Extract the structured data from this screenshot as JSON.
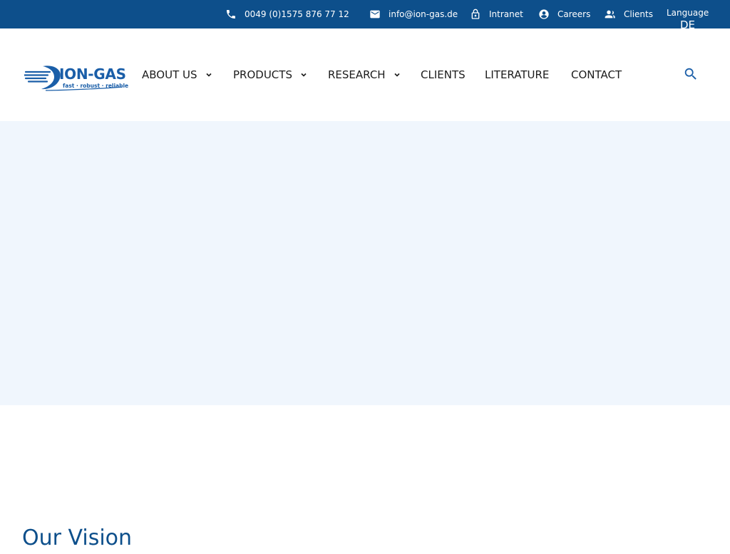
{
  "topbar": {
    "phone": {
      "icon": "phone-icon",
      "label": "0049 (0)1575 876 77 12"
    },
    "email": {
      "icon": "mail-icon",
      "label": "info@ion-gas.de"
    },
    "intranet": {
      "icon": "lock-icon",
      "label": "Intranet"
    },
    "careers": {
      "icon": "account-circle-icon",
      "label": "Careers"
    },
    "clients": {
      "icon": "people-icon",
      "label": "Clients"
    },
    "language": {
      "label": "Language",
      "selected": "DE"
    }
  },
  "logo": {
    "wordmark": "ION-GAS",
    "tagline": "fast · robust · reliable"
  },
  "nav": {
    "items": [
      {
        "label": "ABOUT US",
        "has_dropdown": true
      },
      {
        "label": "PRODUCTS",
        "has_dropdown": true
      },
      {
        "label": "RESEARCH",
        "has_dropdown": true
      },
      {
        "label": "CLIENTS",
        "has_dropdown": false
      },
      {
        "label": "LITERATURE",
        "has_dropdown": false
      },
      {
        "label": "CONTACT",
        "has_dropdown": false
      }
    ],
    "search_icon": "search-icon"
  },
  "main": {
    "vision_title": "Our Vision"
  },
  "colors": {
    "brand_dark_blue": "#0d4f8b",
    "logo_blue": "#1a5ea8",
    "hero_background": "#f0f6fd",
    "nav_text": "#1c1c1c"
  }
}
